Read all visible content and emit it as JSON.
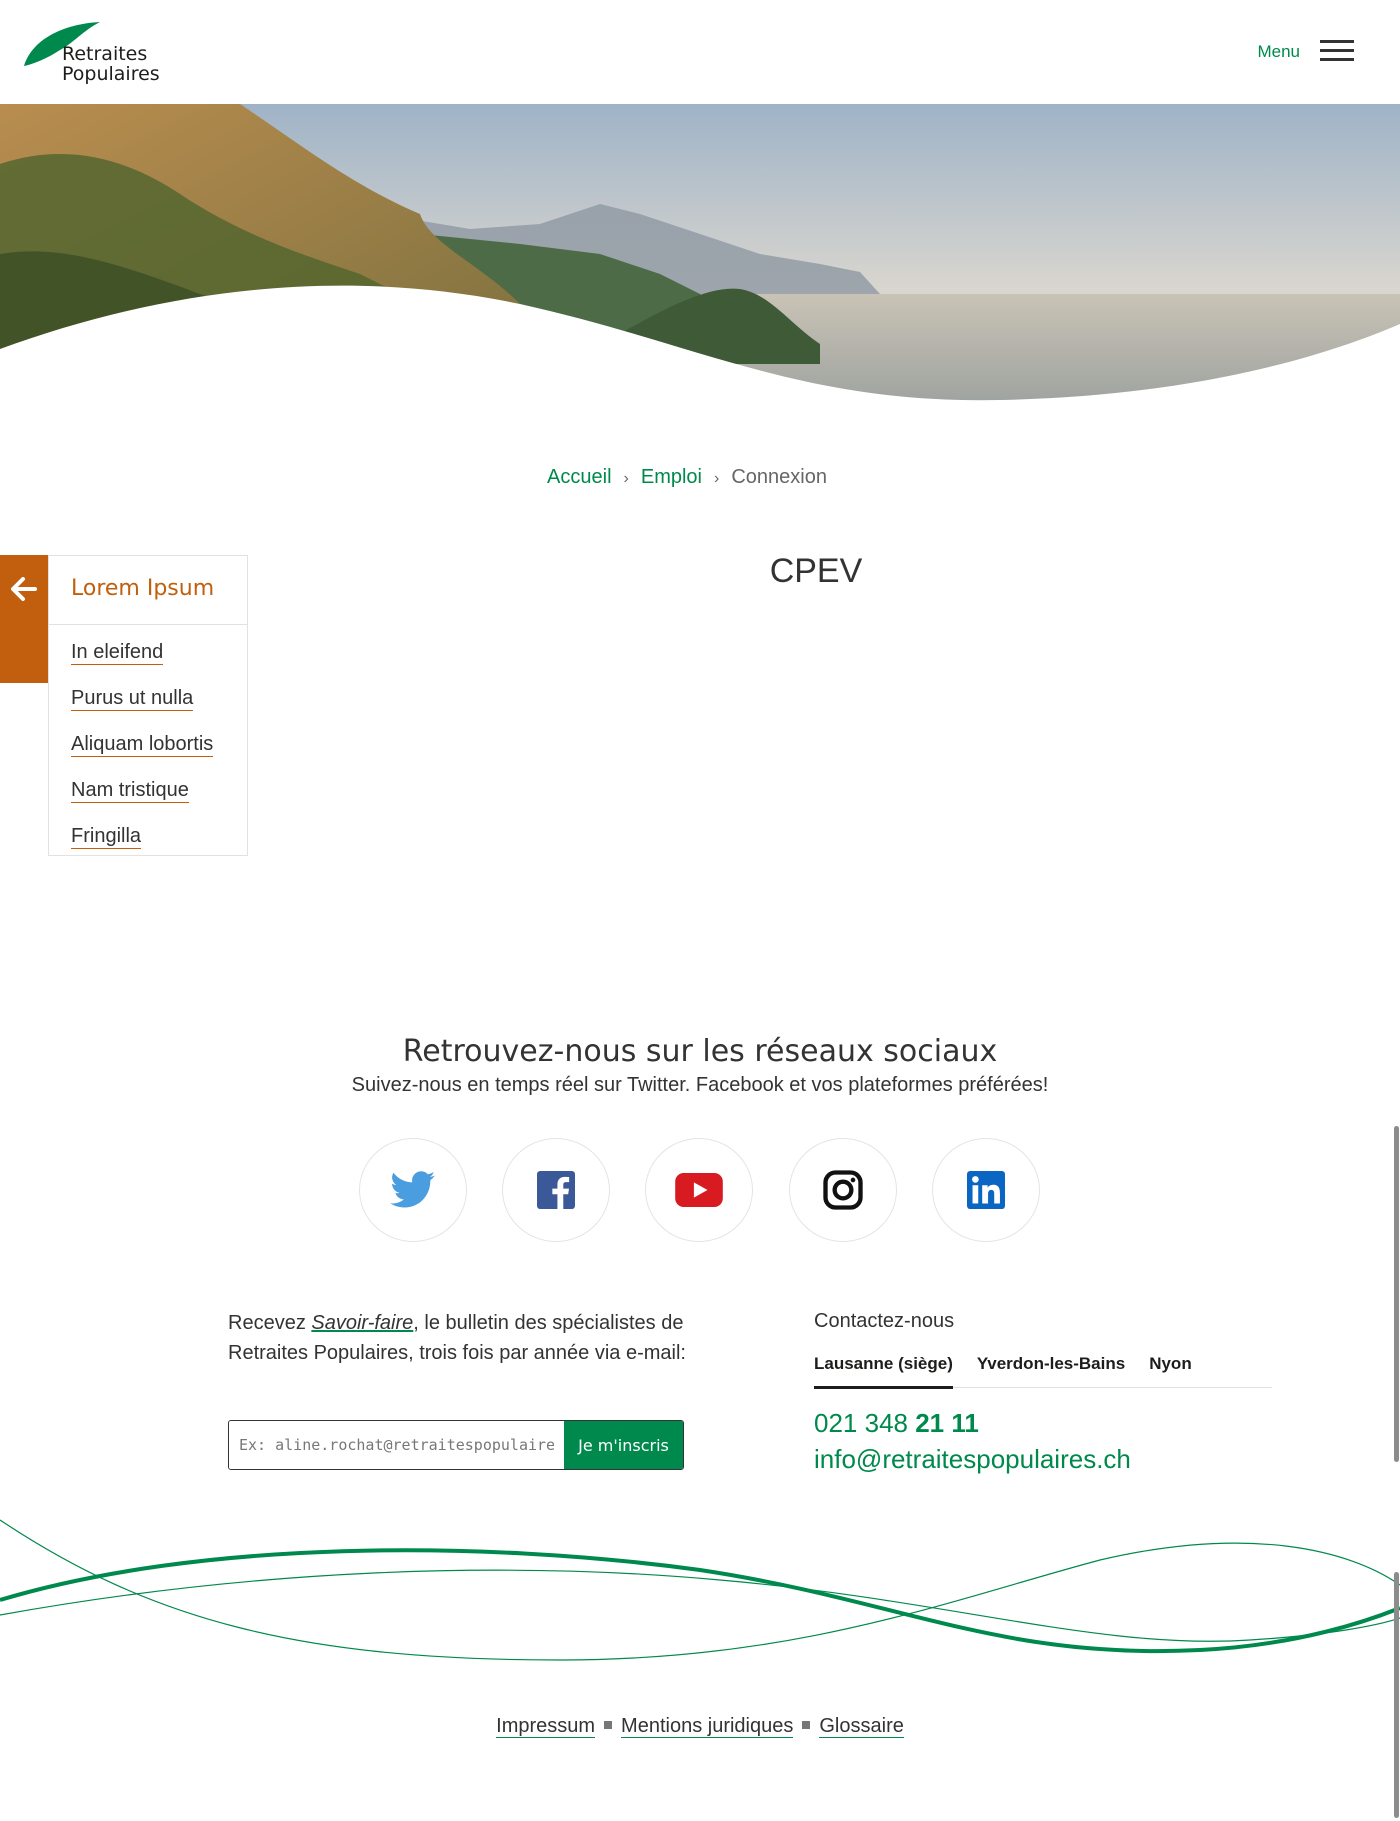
{
  "header": {
    "logo_line1": "Retraites",
    "logo_line2": "Populaires",
    "menu_label": "Menu"
  },
  "breadcrumb": {
    "items": [
      "Accueil",
      "Emploi"
    ],
    "separator": "›",
    "current": "Connexion"
  },
  "sidebar": {
    "title": "Lorem Ipsum",
    "items": [
      "In eleifend",
      "Purus ut nulla",
      "Aliquam lobortis",
      "Nam tristique",
      "Fringilla"
    ]
  },
  "main": {
    "title": "CPEV"
  },
  "social": {
    "title": "Retrouvez-nous sur les réseaux sociaux",
    "subtitle": "Suivez-nous en temps réel sur Twitter. Facebook et vos plateformes préférées!",
    "icons": [
      "twitter-icon",
      "facebook-icon",
      "youtube-icon",
      "instagram-icon",
      "linkedin-icon"
    ]
  },
  "newsletter": {
    "text_before": "Recevez ",
    "text_em": "Savoir-faire",
    "text_after": ", le bulletin des spécialistes de Retraites Populaires, trois fois par année via e-mail:",
    "placeholder": "Ex: aline.rochat@retraitespopulaires.ch",
    "button_label": "Je m'inscris"
  },
  "contact": {
    "title": "Contactez-nous",
    "tabs": [
      "Lausanne (siège)",
      "Yverdon-les-Bains",
      "Nyon"
    ],
    "active_tab": "Lausanne (siège)",
    "phone_prefix": "021 348 ",
    "phone_bold": "21 11",
    "email": "info@retraitespopulaires.ch"
  },
  "footer": {
    "links": [
      "Impressum",
      "Mentions juridiques",
      "Glossaire"
    ]
  },
  "colors": {
    "brand_green": "#00894c",
    "accent_orange": "#c15f0e",
    "text": "#333333"
  }
}
